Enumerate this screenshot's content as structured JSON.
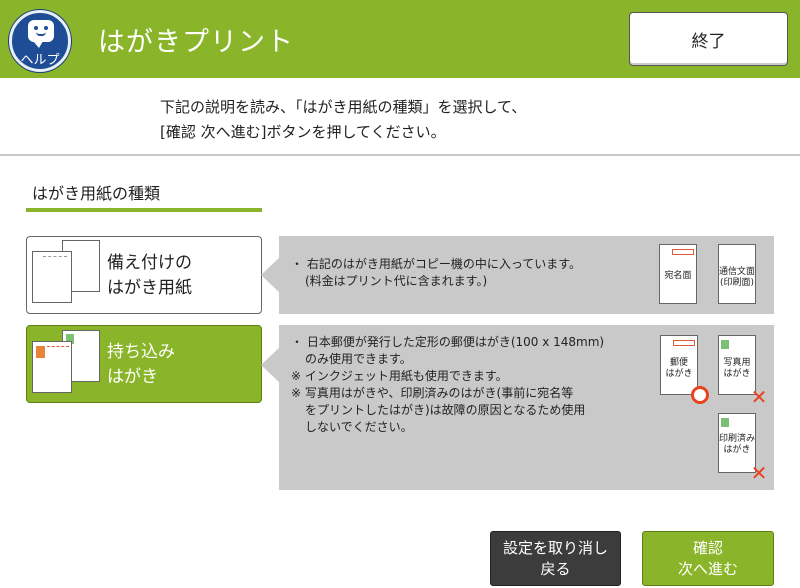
{
  "header": {
    "help_label": "ヘルプ",
    "title": "はがきプリント",
    "end_label": "終了"
  },
  "instructions": {
    "line1": "下記の説明を読み、「はがき用紙の種類」を選択して、",
    "line2": "[確認 次へ進む]ボタンを押してください。"
  },
  "section": {
    "title": "はがき用紙の種類"
  },
  "options": [
    {
      "label_line1": "備え付けの",
      "label_line2": "はがき用紙",
      "selected": false,
      "desc": [
        "・ 右記のはがき用紙がコピー機の中に入っています。",
        "(料金はプリント代に含まれます。)"
      ],
      "cards": [
        "宛名面",
        "通信文面\n(印刷面)"
      ]
    },
    {
      "label_line1": "持ち込み",
      "label_line2": "はがき",
      "selected": true,
      "desc": [
        "・ 日本郵便が発行した定形の郵便はがき(100 x 148mm)",
        "のみ使用できます。",
        "※ インクジェット用紙も使用できます。",
        "※ 写真用はがきや、印刷済みのはがき(事前に宛名等",
        "をプリントしたはがき)は故障の原因となるため使用",
        "しないでください。"
      ],
      "cards": [
        "郵便\nはがき",
        "写真用\nはがき",
        "印刷済み\nはがき"
      ]
    }
  ],
  "buttons": {
    "cancel_line1": "設定を取り消し",
    "cancel_line2": "戻る",
    "confirm_line1": "確認",
    "confirm_line2": "次へ進む"
  },
  "colors": {
    "accent_green": "#8ab52a",
    "help_blue": "#1e4d95",
    "panel_gray": "#c9c9c9",
    "mark_red": "#e8431e"
  }
}
